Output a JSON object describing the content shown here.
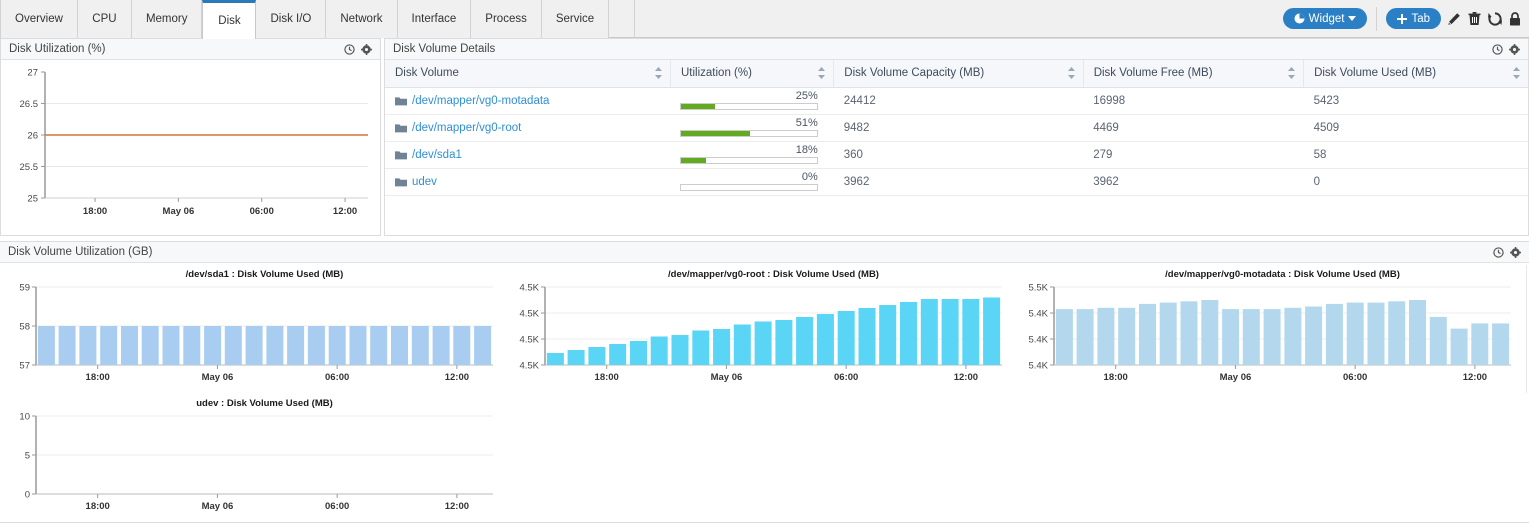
{
  "tabs": [
    {
      "label": "Overview",
      "active": false
    },
    {
      "label": "CPU",
      "active": false
    },
    {
      "label": "Memory",
      "active": false
    },
    {
      "label": "Disk",
      "active": true
    },
    {
      "label": "Disk I/O",
      "active": false
    },
    {
      "label": "Network",
      "active": false
    },
    {
      "label": "Interface",
      "active": false
    },
    {
      "label": "Process",
      "active": false
    },
    {
      "label": "Service",
      "active": false
    }
  ],
  "toolbar": {
    "widget_label": "Widget",
    "tab_label": "Tab",
    "icons": [
      "pencil-icon",
      "trash-icon",
      "refresh-icon",
      "lock-icon"
    ],
    "accent_color": "#2b7fc4"
  },
  "panels": {
    "disk_utilization": {
      "title": "Disk Utilization (%)",
      "icons": [
        "clock-icon",
        "gear-icon"
      ]
    },
    "disk_volume_details": {
      "title": "Disk Volume Details",
      "icons": [
        "clock-icon",
        "gear-icon"
      ]
    },
    "disk_volume_utilization": {
      "title": "Disk Volume Utilization (GB)",
      "icons": [
        "clock-icon",
        "gear-icon"
      ]
    }
  },
  "table": {
    "columns": [
      "Disk Volume",
      "Utilization (%)",
      "Disk Volume Capacity (MB)",
      "Disk Volume Free (MB)",
      "Disk Volume Used (MB)"
    ],
    "rows": [
      {
        "volume": "/dev/mapper/vg0-motadata",
        "utilization_label": "25%",
        "utilization_value": 25,
        "capacity": "24412",
        "free": "16998",
        "used": "5423"
      },
      {
        "volume": "/dev/mapper/vg0-root",
        "utilization_label": "51%",
        "utilization_value": 51,
        "capacity": "9482",
        "free": "4469",
        "used": "4509"
      },
      {
        "volume": "/dev/sda1",
        "utilization_label": "18%",
        "utilization_value": 18,
        "capacity": "360",
        "free": "279",
        "used": "58"
      },
      {
        "volume": "udev",
        "utilization_label": "0%",
        "utilization_value": 0,
        "capacity": "3962",
        "free": "3962",
        "used": "0"
      }
    ],
    "bar_color": "#62aa1e",
    "link_color": "#2f8fd4"
  },
  "chart_data": [
    {
      "id": "disk-utilization-line",
      "type": "line",
      "title": "",
      "xlabel": "",
      "ylabel": "",
      "ytick_labels": [
        "27",
        "26.5",
        "26",
        "25.5",
        "25"
      ],
      "ylim": [
        25,
        27
      ],
      "xtick_labels": [
        "18:00",
        "May 06",
        "06:00",
        "12:00"
      ],
      "series": [
        {
          "name": "Disk Utilization (%)",
          "color": "#d4743a",
          "values": [
            26,
            26,
            26,
            26,
            26,
            26,
            26,
            26,
            26,
            26,
            26,
            26,
            26,
            26,
            26,
            26,
            26,
            26,
            26,
            26,
            26,
            26,
            26,
            26
          ]
        }
      ],
      "grid": true
    },
    {
      "id": "sda1-used",
      "type": "bar",
      "title": "/dev/sda1 : Disk Volume Used (MB)",
      "xlabel": "",
      "ylabel": "",
      "ytick_labels": [
        "59",
        "58",
        "57"
      ],
      "ylim": [
        57,
        59
      ],
      "xtick_labels": [
        "18:00",
        "May 06",
        "06:00",
        "12:00"
      ],
      "bar_color": "#a8cdf0",
      "values": [
        58,
        58,
        58,
        58,
        58,
        58,
        58,
        58,
        58,
        58,
        58,
        58,
        58,
        58,
        58,
        58,
        58,
        58,
        58,
        58,
        58,
        58
      ],
      "grid": true
    },
    {
      "id": "vg0-root-used",
      "type": "bar",
      "title": "/dev/mapper/vg0-root : Disk Volume Used (MB)",
      "xlabel": "",
      "ylabel": "",
      "ytick_labels": [
        "4.5K",
        "4.5K",
        "4.5K",
        "4.5K"
      ],
      "ylim": [
        4460,
        4512
      ],
      "xtick_labels": [
        "18:00",
        "May 06",
        "06:00",
        "12:00"
      ],
      "bar_color": "#5ad5f5",
      "values": [
        4468,
        4470,
        4472,
        4474,
        4476,
        4479,
        4480,
        4483,
        4484,
        4487,
        4489,
        4490,
        4492,
        4494,
        4496,
        4498,
        4500,
        4502,
        4504,
        4504,
        4504,
        4505
      ],
      "grid": true
    },
    {
      "id": "vg0-motadata-used",
      "type": "bar",
      "title": "/dev/mapper/vg0-motadata : Disk Volume Used (MB)",
      "xlabel": "",
      "ylabel": "",
      "ytick_labels": [
        "5.5K",
        "5.4K",
        "5.4K",
        "5.4K"
      ],
      "ylim": [
        5400,
        5460
      ],
      "xtick_labels": [
        "18:00",
        "May 06",
        "06:00",
        "12:00"
      ],
      "bar_color": "#b3d8ee",
      "values": [
        5443,
        5443,
        5444,
        5444,
        5447,
        5448,
        5449,
        5450,
        5443,
        5443,
        5443,
        5444,
        5445,
        5447,
        5448,
        5448,
        5449,
        5450,
        5437,
        5428,
        5432,
        5432
      ],
      "grid": true
    },
    {
      "id": "udev-used",
      "type": "bar",
      "title": "udev : Disk Volume Used (MB)",
      "xlabel": "",
      "ylabel": "",
      "ytick_labels": [
        "10",
        "5",
        "0"
      ],
      "ylim": [
        0,
        10
      ],
      "xtick_labels": [
        "18:00",
        "May 06",
        "06:00",
        "12:00"
      ],
      "bar_color": "#a8cdf0",
      "values": [
        0,
        0,
        0,
        0,
        0,
        0,
        0,
        0,
        0,
        0,
        0,
        0,
        0,
        0,
        0,
        0,
        0,
        0,
        0,
        0,
        0,
        0
      ],
      "grid": true
    }
  ]
}
